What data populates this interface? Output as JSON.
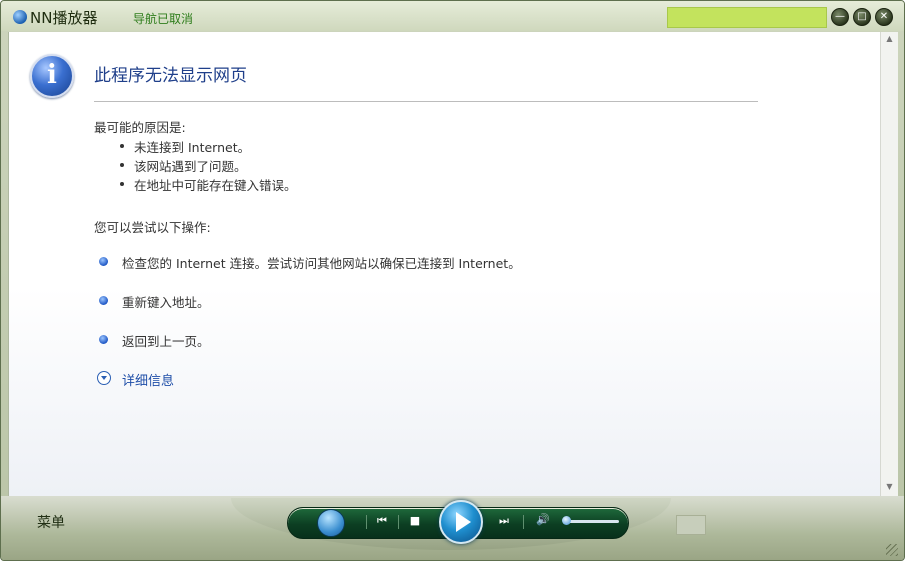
{
  "titlebar": {
    "app_title": "NN播放器",
    "nav_status": "导航已取消",
    "controls": {
      "minimize": "—",
      "restore": "□",
      "close": "✕"
    },
    "green_field_color": "#c3e35d"
  },
  "page": {
    "heading": "此程序无法显示网页",
    "reasons_title": "最可能的原因是:",
    "reasons": [
      "未连接到 Internet。",
      "该网站遇到了问题。",
      "在地址中可能存在键入错误。"
    ],
    "actions_title": "您可以尝试以下操作:",
    "actions": [
      "检查您的 Internet 连接。尝试访问其他网站以确保已连接到 Internet。",
      "重新键入地址。",
      "返回到上一页。"
    ],
    "more_info": "详细信息"
  },
  "player": {
    "menu_label": "菜单",
    "icons": {
      "library": "library-icon",
      "prev": "⏮",
      "stop": "■",
      "play": "play-icon",
      "next": "⏭",
      "volume": "🔊"
    },
    "volume_level": 0.05
  },
  "colors": {
    "heading": "#1f3f8a",
    "link": "#1f4ea8",
    "control_bar": "#0c3e22"
  }
}
